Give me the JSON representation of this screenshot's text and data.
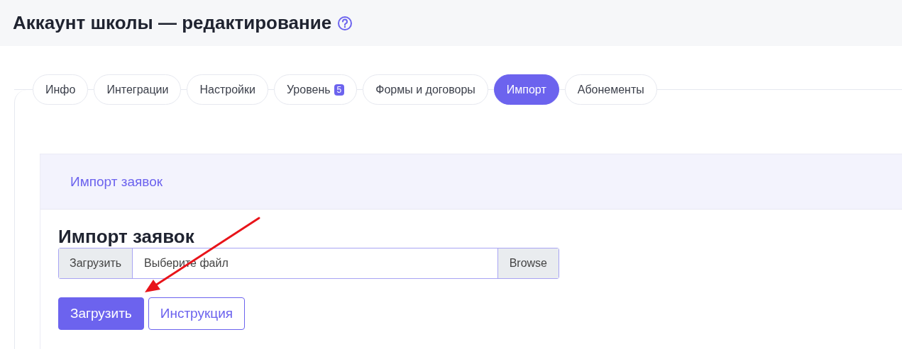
{
  "page_title": "Аккаунт школы — редактирование",
  "tabs": [
    {
      "label": "Инфо",
      "selected": false
    },
    {
      "label": "Интеграции",
      "selected": false
    },
    {
      "label": "Настройки",
      "selected": false
    },
    {
      "label": "Уровень",
      "badge": "5",
      "selected": false
    },
    {
      "label": "Формы и договоры",
      "selected": false
    },
    {
      "label": "Импорт",
      "selected": true
    },
    {
      "label": "Абонементы",
      "selected": false
    }
  ],
  "card": {
    "header": "Импорт заявок",
    "heading": "Импорт заявок",
    "file_input": {
      "prefix": "Загрузить",
      "placeholder": "Выберите файл",
      "browse": "Browse"
    },
    "buttons": [
      {
        "label": "Загрузить",
        "kind": "primary"
      },
      {
        "label": "Инструкция",
        "kind": "outline"
      }
    ]
  }
}
